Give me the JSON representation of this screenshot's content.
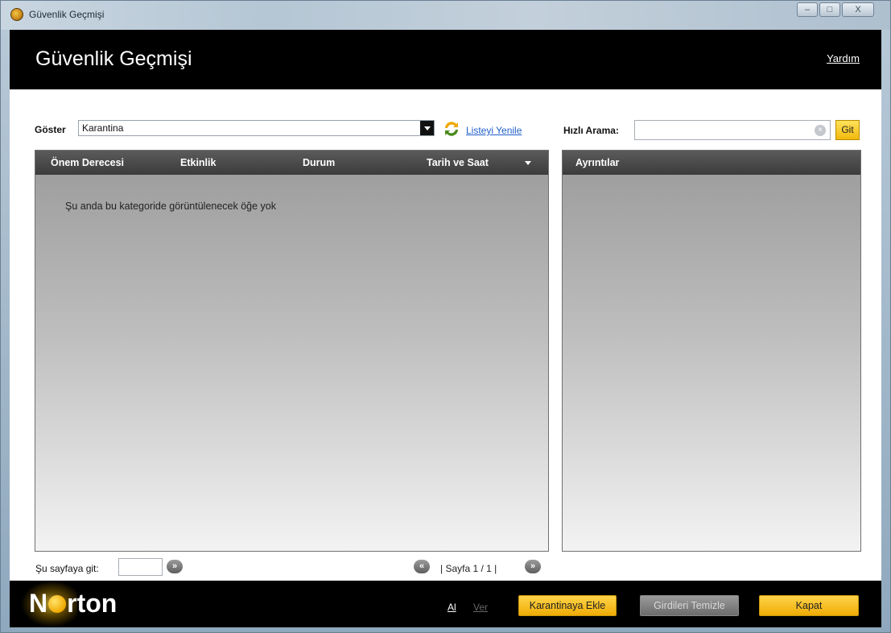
{
  "window": {
    "title": "Güvenlik Geçmişi",
    "controls": {
      "minimize": "–",
      "maximize": "□",
      "close": "X"
    }
  },
  "header": {
    "page_title": "Güvenlik Geçmişi",
    "help_link": "Yardım"
  },
  "filter": {
    "show_label": "Göster",
    "selected": "Karantina",
    "refresh_link": "Listeyi Yenile"
  },
  "search": {
    "label": "Hızlı Arama:",
    "value": "",
    "clear_icon": "×",
    "go_button": "Git"
  },
  "list": {
    "columns": [
      "Önem Derecesi",
      "Etkinlik",
      "Durum",
      "Tarih ve Saat"
    ],
    "empty_message": "Şu anda bu kategoride görüntülenecek öğe yok"
  },
  "details": {
    "title": "Ayrıntılar"
  },
  "pagination": {
    "goto_label": "Şu sayfaya git:",
    "goto_value": "",
    "go_icon": "»",
    "prev_icon": "«",
    "next_icon": "»",
    "page_text": "| Sayfa 1 / 1 |"
  },
  "footer": {
    "logo_prefix": "N",
    "logo_suffix": "rton",
    "import_link": "Al",
    "export_link": "Ver",
    "add_to_quarantine": "Karantinaya Ekle",
    "clear_entries": "Girdileri Temizle",
    "close_button": "Kapat"
  },
  "colors": {
    "accent_yellow": "#f2b90c",
    "header_bg": "#000000",
    "link_blue": "#1f5fc9"
  }
}
